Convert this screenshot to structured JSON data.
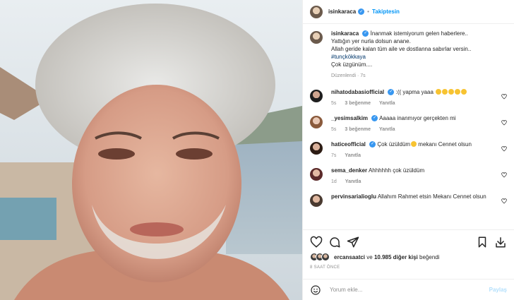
{
  "header": {
    "username": "isinkaraca",
    "separator": "•",
    "follow_label": "Takiptesin"
  },
  "caption": {
    "username": "isinkaraca",
    "lines": [
      "İnanmak istemiyorum gelen haberlere..",
      "Yattığın yer nurla dolsun anane.",
      "Allah geride kalan tüm aile ve dostlanna sabırlar versin..",
      "#tunçkökkaya",
      "Çok üzgünüm...."
    ],
    "edited": "Düzenlendi · 7s"
  },
  "comments": [
    {
      "username": "nihatodabasiofficial",
      "text": ":(( yapma yaaa",
      "emoji_count": 5,
      "time": "5s",
      "likes": "3 beğenme",
      "reply": "Yanıtla"
    },
    {
      "username": "_yesimsalkim",
      "text": "Aaaaa inanmıyor gerçekten mi",
      "emoji_count": 0,
      "time": "5s",
      "likes": "3 beğenme",
      "reply": "Yanıtla"
    },
    {
      "username": "haticeofficial",
      "text": "Çok üzüldüm",
      "text_after": "mekanı Cennet olsun",
      "emoji_count": 1,
      "time": "7s",
      "likes": "",
      "reply": "Yanıtla"
    },
    {
      "username": "sema_denker",
      "text": "Ahhhhhh çok üzüldüm",
      "emoji_count": 0,
      "time": "1d",
      "likes": "",
      "reply": "Yanıtla"
    },
    {
      "username": "pervinsarialioglu",
      "text": "Allahım Rahmet etsin Mekanı Cennet olsun",
      "emoji_count": 0,
      "time": "",
      "likes": "",
      "reply": ""
    }
  ],
  "likes": {
    "user": "ercansaatci",
    "connector": "ve",
    "others": "10.985 diğer kişi",
    "suffix": "beğendi"
  },
  "time_ago": "8 SAAT ÖNCE",
  "composer": {
    "placeholder": "Yorum ekle...",
    "post_label": "Paylaş"
  },
  "icons": {
    "like": "heart-icon",
    "comment": "comment-icon",
    "share": "share-icon",
    "save": "bookmark-icon",
    "download": "download-icon",
    "emoji": "smile-icon"
  },
  "colors": {
    "link_blue": "#0095f6",
    "verified": "#3897f0",
    "hashtag": "#00376b",
    "muted": "#8e8e8e"
  }
}
